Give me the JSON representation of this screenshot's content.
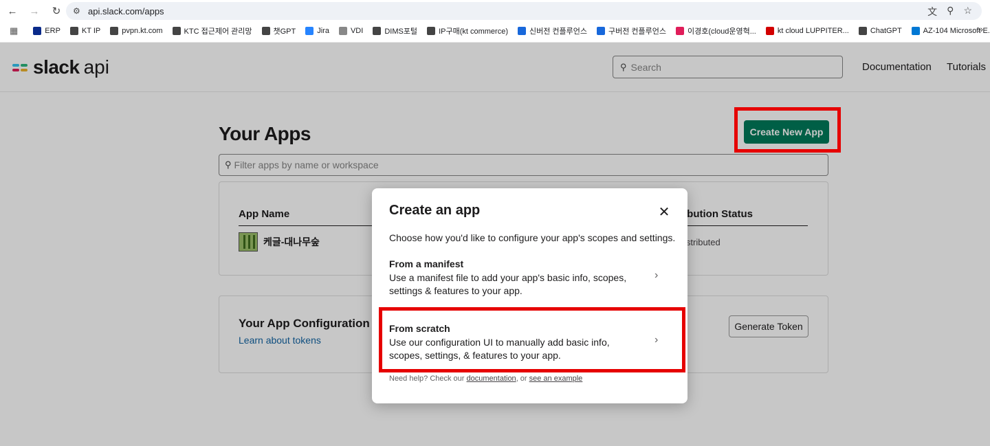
{
  "browser": {
    "url": "api.slack.com/apps",
    "bookmarks": [
      {
        "label": "ERP",
        "color": "#0a2a8a"
      },
      {
        "label": "KT IP",
        "color": "#444444"
      },
      {
        "label": "pvpn.kt.com",
        "color": "#444444"
      },
      {
        "label": "KTC 접근제어 관리망",
        "color": "#444444"
      },
      {
        "label": "챗GPT",
        "color": "#444444"
      },
      {
        "label": "Jira",
        "color": "#2684ff"
      },
      {
        "label": "VDI",
        "color": "#888888"
      },
      {
        "label": "DIMS포털",
        "color": "#444444"
      },
      {
        "label": "IP구매(kt commerce)",
        "color": "#444444"
      },
      {
        "label": "신버전 컨플루언스",
        "color": "#1868db"
      },
      {
        "label": "구버전 컨플루언스",
        "color": "#1868db"
      },
      {
        "label": "이경호(cloud운영혁...",
        "color": "#e01e5a"
      },
      {
        "label": "kt cloud LUPPITER...",
        "color": "#d20000"
      },
      {
        "label": "ChatGPT",
        "color": "#444444"
      },
      {
        "label": "AZ-104 Microsoft E...",
        "color": "#0078d4"
      }
    ]
  },
  "header": {
    "logo_text": "slack",
    "logo_suffix": "api",
    "search_placeholder": "Search",
    "nav": [
      "Documentation",
      "Tutorials"
    ]
  },
  "page": {
    "title": "Your Apps",
    "create_button": "Create New App",
    "filter_placeholder": "Filter apps by name or workspace",
    "columns": {
      "app_name": "App Name",
      "distribution_status": "ibution Status"
    },
    "apps": [
      {
        "name": "케글-대나무숲",
        "status": "istributed"
      }
    ],
    "config_title": "Your App Configuration T",
    "config_link": "Learn about tokens",
    "generate_button": "Generate Token"
  },
  "modal": {
    "title": "Create an app",
    "subtitle": "Choose how you'd like to configure your app's scopes and settings.",
    "options": [
      {
        "title": "From a manifest",
        "desc": "Use a manifest file to add your app's basic info, scopes, settings & features to your app."
      },
      {
        "title": "From scratch",
        "desc": "Use our configuration UI to manually add basic info, scopes, settings, & features to your app."
      }
    ],
    "help_prefix": "Need help? Check our ",
    "help_link1": "documentation",
    "help_mid": ", or ",
    "help_link2": "see an example"
  },
  "colors": {
    "brand_green": "#007a5a",
    "highlight_red": "#e60000",
    "link_blue": "#1264a3"
  }
}
